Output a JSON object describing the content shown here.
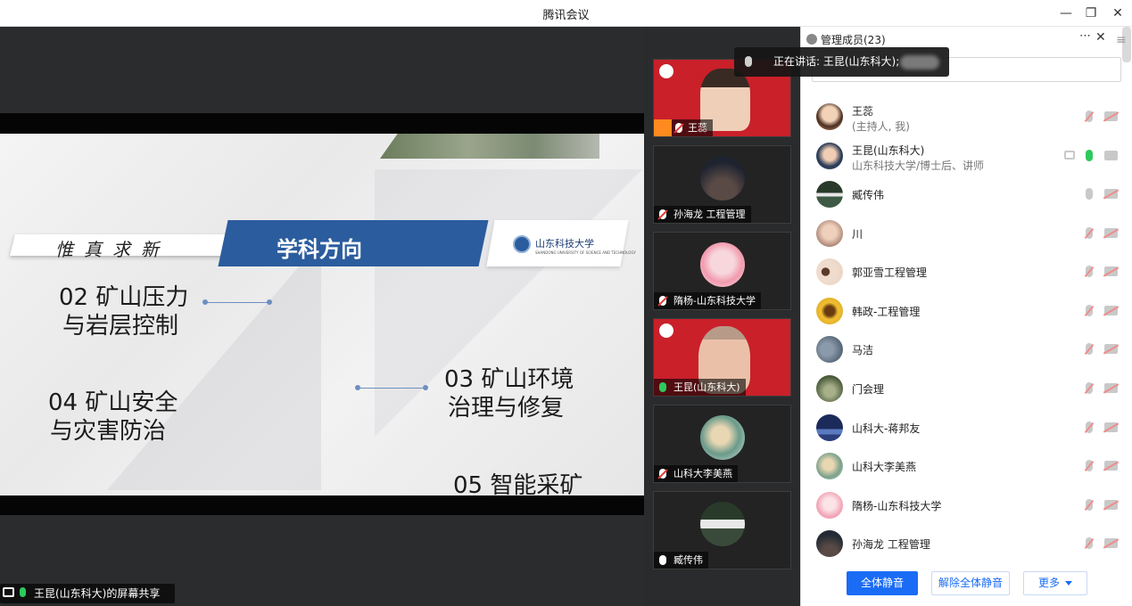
{
  "app": {
    "title": "腾讯会议"
  },
  "window": {
    "minimize": "—",
    "restore": "❐",
    "close": "✕"
  },
  "slide": {
    "motto": "惟真求新",
    "heading": "学科方向",
    "university_logo_text": "山东科技大学",
    "university_logo_sub": "SHANDONG UNIVERSITY OF SCIENCE AND TECHNOLOGY",
    "items": [
      {
        "line1": "02 矿山压力",
        "line2": "与岩层控制"
      },
      {
        "line1": "03 矿山环境",
        "line2": "治理与修复"
      },
      {
        "line1": "04 矿山安全",
        "line2": "与灾害防治"
      },
      {
        "line1": "05 智能采矿",
        "line2": ""
      }
    ]
  },
  "share_status": "王昆(山东科大)的屏幕共享",
  "speaking": {
    "text": "正在讲话: 王昆(山东科大);"
  },
  "video_tiles": [
    {
      "name": "王蕊",
      "mic": "muted"
    },
    {
      "name": "孙海龙  工程管理",
      "mic": "muted"
    },
    {
      "name": "隋杨-山东科技大学",
      "mic": "muted"
    },
    {
      "name": "王昆(山东科大)",
      "mic": "live"
    },
    {
      "name": "山科大李美燕",
      "mic": "muted"
    },
    {
      "name": "臧传伟",
      "mic": "on"
    }
  ],
  "panel": {
    "title": "管理成员(23)",
    "more": "⋯",
    "close": "✕",
    "menu": "≡",
    "members": [
      {
        "name": "王蕊",
        "sub": "(主持人, 我)",
        "mic": "muted",
        "cam": "off",
        "avatar_color": "#d9a06b"
      },
      {
        "name": "王昆(山东科大)",
        "sub": "山东科技大学/博士后、讲师",
        "mic": "live",
        "cam": "on",
        "screen": true,
        "avatar_color": "#3b5a7a"
      },
      {
        "name": "臧传伟",
        "sub": "",
        "mic": "on",
        "cam": "off",
        "avatar_color": "#3e5a44"
      },
      {
        "name": "川",
        "sub": "",
        "mic": "muted",
        "cam": "off",
        "avatar_color": "#b08a7a"
      },
      {
        "name": "郭亚雪工程管理",
        "sub": "",
        "mic": "muted",
        "cam": "off",
        "avatar_color": "#e8d2c2"
      },
      {
        "name": "韩政-工程管理",
        "sub": "",
        "mic": "muted",
        "cam": "off",
        "avatar_color": "#d4a02a"
      },
      {
        "name": "马洁",
        "sub": "",
        "mic": "muted",
        "cam": "off",
        "avatar_color": "#5a6a7a"
      },
      {
        "name": "门会理",
        "sub": "",
        "mic": "muted",
        "cam": "off",
        "avatar_color": "#4a5a3a"
      },
      {
        "name": "山科大-蒋邦友",
        "sub": "",
        "mic": "muted",
        "cam": "off",
        "avatar_color": "#2c3e7a"
      },
      {
        "name": "山科大李美燕",
        "sub": "",
        "mic": "muted",
        "cam": "off",
        "avatar_color": "#7aa08a"
      },
      {
        "name": "隋杨-山东科技大学",
        "sub": "",
        "mic": "muted",
        "cam": "off",
        "avatar_color": "#f2a3b5"
      },
      {
        "name": "孙海龙  工程管理",
        "sub": "",
        "mic": "muted",
        "cam": "off",
        "avatar_color": "#222a33"
      }
    ],
    "buttons": {
      "mute_all": "全体静音",
      "unmute_all": "解除全体静音",
      "more": "更多"
    }
  }
}
